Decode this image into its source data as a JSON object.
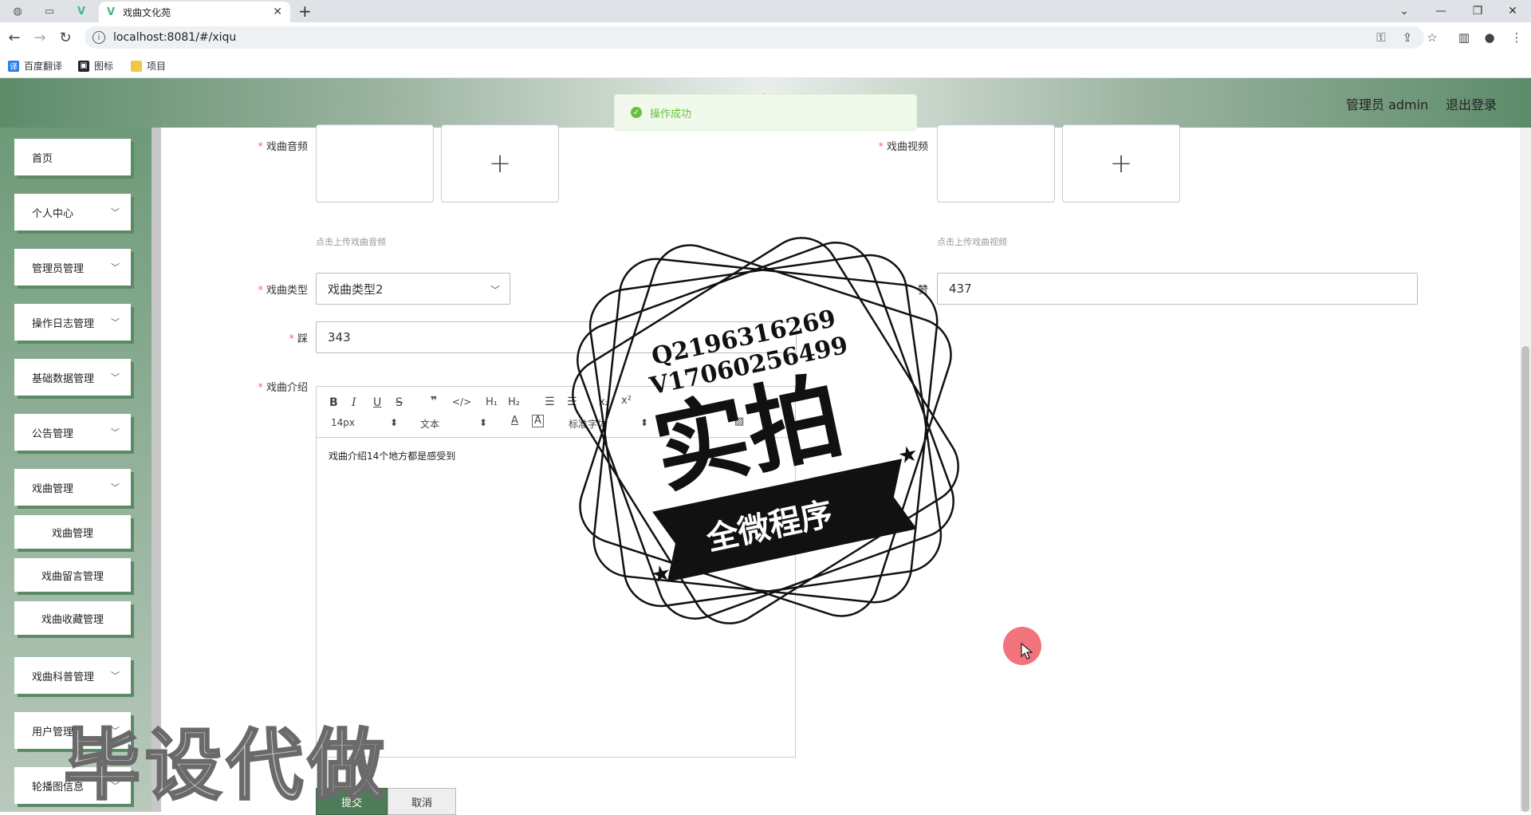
{
  "browser": {
    "tab_title": "戏曲文化苑",
    "url": "localhost:8081/#/xiqu",
    "bookmarks": [
      "百度翻译",
      "图标",
      "项目"
    ]
  },
  "header": {
    "site_title": "戏曲文化苑",
    "user": "管理员 admin",
    "logout": "退出登录"
  },
  "toast": {
    "message": "操作成功"
  },
  "sidebar": {
    "items": [
      {
        "label": "首页"
      },
      {
        "label": "个人中心"
      },
      {
        "label": "管理员管理"
      },
      {
        "label": "操作日志管理"
      },
      {
        "label": "基础数据管理"
      },
      {
        "label": "公告管理"
      },
      {
        "label": "戏曲管理"
      },
      {
        "label": "戏曲科普管理"
      },
      {
        "label": "用户管理"
      },
      {
        "label": "轮播图信息"
      }
    ],
    "sub_items": [
      {
        "label": "戏曲管理"
      },
      {
        "label": "戏曲留言管理"
      },
      {
        "label": "戏曲收藏管理"
      }
    ]
  },
  "form": {
    "audio_label": "戏曲音频",
    "audio_hint": "点击上传戏曲音频",
    "video_label": "戏曲视频",
    "video_hint": "点击上传戏曲视频",
    "type_label": "戏曲类型",
    "type_value": "戏曲类型2",
    "right_label_partial": "赞",
    "right_value": "437",
    "left_label_partial": "踩",
    "left_value": "343",
    "intro_label": "戏曲介绍",
    "submit": "提交",
    "cancel": "取消"
  },
  "editor": {
    "font_size": "14px",
    "paragraph": "文本",
    "font_family": "标准字体",
    "content": "戏曲介绍14个地方都是感受到"
  },
  "stamp": {
    "qq": "Q2196316269",
    "vx": "V17060256499",
    "main": "实拍",
    "banner": "全微程序"
  },
  "watermark": "毕设代做",
  "colors": {
    "primary": "#4e7c58",
    "success": "#67c23a",
    "required": "#f56c6c"
  }
}
